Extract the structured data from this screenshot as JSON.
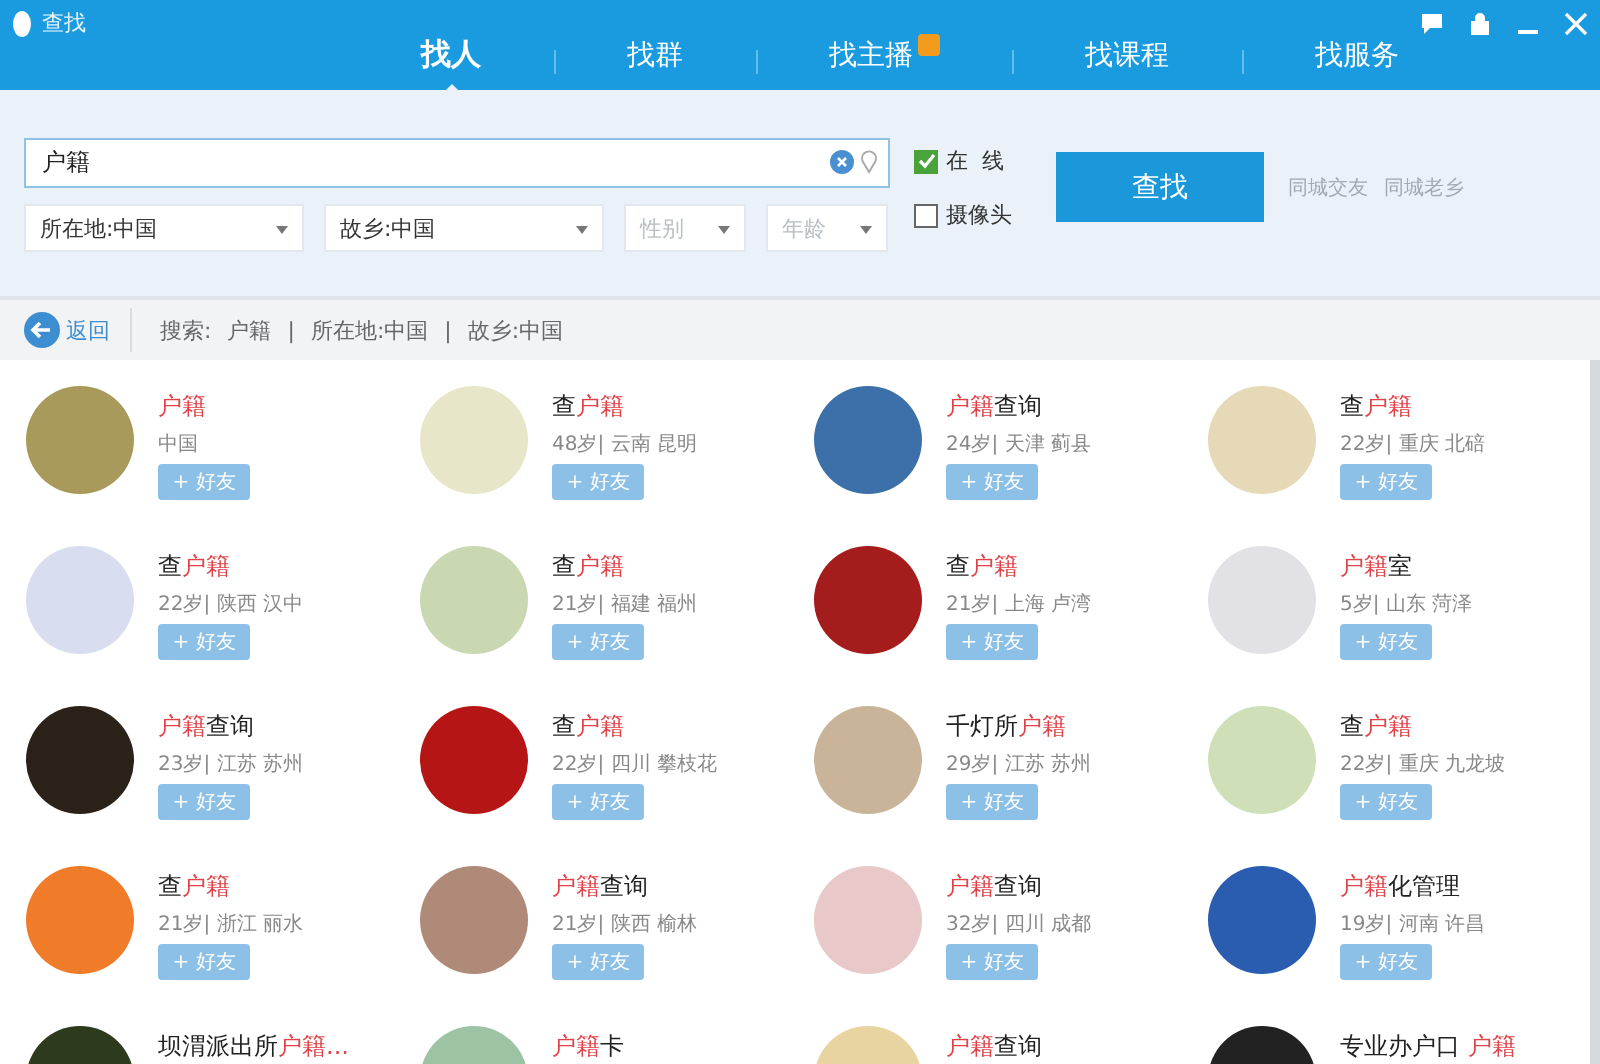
{
  "window": {
    "title": "查找"
  },
  "tabs": [
    {
      "label": "找人",
      "selected": true,
      "hot": false
    },
    {
      "label": "找群",
      "selected": false,
      "hot": false
    },
    {
      "label": "找主播",
      "selected": false,
      "hot": true
    },
    {
      "label": "找课程",
      "selected": false,
      "hot": false
    },
    {
      "label": "找服务",
      "selected": false,
      "hot": false
    }
  ],
  "search": {
    "value": "户籍"
  },
  "filters": [
    {
      "label": "所在地:中国",
      "muted": false
    },
    {
      "label": "故乡:中国",
      "muted": false
    },
    {
      "label": "性别",
      "muted": true
    },
    {
      "label": "年龄",
      "muted": true
    }
  ],
  "options": [
    {
      "label": "在  线",
      "checked": true
    },
    {
      "label": "摄像头",
      "checked": false
    }
  ],
  "search_button": "查找",
  "links": [
    "同城交友",
    "同城老乡"
  ],
  "breadcrumb": {
    "back": "返回",
    "label": "搜索:",
    "terms": [
      "户籍",
      "|",
      "所在地:中国",
      "|",
      "故乡:中国"
    ]
  },
  "results": [
    {
      "name": [
        {
          "text": "户籍",
          "match": true
        }
      ],
      "info": "中国",
      "add": "+ 好友"
    },
    {
      "name": [
        {
          "text": "查",
          "match": false
        },
        {
          "text": "户籍",
          "match": true
        }
      ],
      "info": "48岁| 云南 昆明",
      "add": "+ 好友"
    },
    {
      "name": [
        {
          "text": "户籍",
          "match": true
        },
        {
          "text": "查询",
          "match": false
        }
      ],
      "info": "24岁| 天津 蓟县",
      "add": "+ 好友"
    },
    {
      "name": [
        {
          "text": "查",
          "match": false
        },
        {
          "text": "户籍",
          "match": true
        }
      ],
      "info": "22岁| 重庆 北碚",
      "add": "+ 好友"
    },
    {
      "name": [
        {
          "text": "查",
          "match": false
        },
        {
          "text": "户籍",
          "match": true
        }
      ],
      "info": "22岁| 陕西 汉中",
      "add": "+ 好友"
    },
    {
      "name": [
        {
          "text": "查",
          "match": false
        },
        {
          "text": "户籍",
          "match": true
        }
      ],
      "info": "21岁| 福建 福州",
      "add": "+ 好友"
    },
    {
      "name": [
        {
          "text": "查",
          "match": false
        },
        {
          "text": "户籍",
          "match": true
        }
      ],
      "info": "21岁| 上海 卢湾",
      "add": "+ 好友"
    },
    {
      "name": [
        {
          "text": "户籍",
          "match": true
        },
        {
          "text": "室",
          "match": false
        }
      ],
      "info": "5岁| 山东 菏泽",
      "add": "+ 好友"
    },
    {
      "name": [
        {
          "text": "户籍",
          "match": true
        },
        {
          "text": "查询",
          "match": false
        }
      ],
      "info": "23岁| 江苏 苏州",
      "add": "+ 好友"
    },
    {
      "name": [
        {
          "text": "查",
          "match": false
        },
        {
          "text": "户籍",
          "match": true
        }
      ],
      "info": "22岁| 四川 攀枝花",
      "add": "+ 好友"
    },
    {
      "name": [
        {
          "text": "千灯所",
          "match": false
        },
        {
          "text": "户籍",
          "match": true
        }
      ],
      "info": "29岁| 江苏 苏州",
      "add": "+ 好友"
    },
    {
      "name": [
        {
          "text": "查",
          "match": false
        },
        {
          "text": "户籍",
          "match": true
        }
      ],
      "info": "22岁| 重庆 九龙坡",
      "add": "+ 好友"
    },
    {
      "name": [
        {
          "text": "查",
          "match": false
        },
        {
          "text": "户籍",
          "match": true
        }
      ],
      "info": "21岁| 浙江 丽水",
      "add": "+ 好友"
    },
    {
      "name": [
        {
          "text": "户籍",
          "match": true
        },
        {
          "text": "查询",
          "match": false
        }
      ],
      "info": "21岁| 陕西 榆林",
      "add": "+ 好友"
    },
    {
      "name": [
        {
          "text": "户籍",
          "match": true
        },
        {
          "text": "查询",
          "match": false
        }
      ],
      "info": "32岁| 四川 成都",
      "add": "+ 好友"
    },
    {
      "name": [
        {
          "text": "户籍",
          "match": true
        },
        {
          "text": "化管理",
          "match": false
        }
      ],
      "info": "19岁| 河南 许昌",
      "add": "+ 好友"
    },
    {
      "name": [
        {
          "text": "坝渭派出所",
          "match": false
        },
        {
          "text": "户籍...",
          "match": true
        }
      ]
    },
    {
      "name": [
        {
          "text": "户籍",
          "match": true
        },
        {
          "text": "卡",
          "match": false
        }
      ]
    },
    {
      "name": [
        {
          "text": "户籍",
          "match": true
        },
        {
          "text": "查询",
          "match": false
        }
      ]
    },
    {
      "name": [
        {
          "text": "专业办户口 ",
          "match": false
        },
        {
          "text": "户籍",
          "match": true
        }
      ]
    }
  ]
}
